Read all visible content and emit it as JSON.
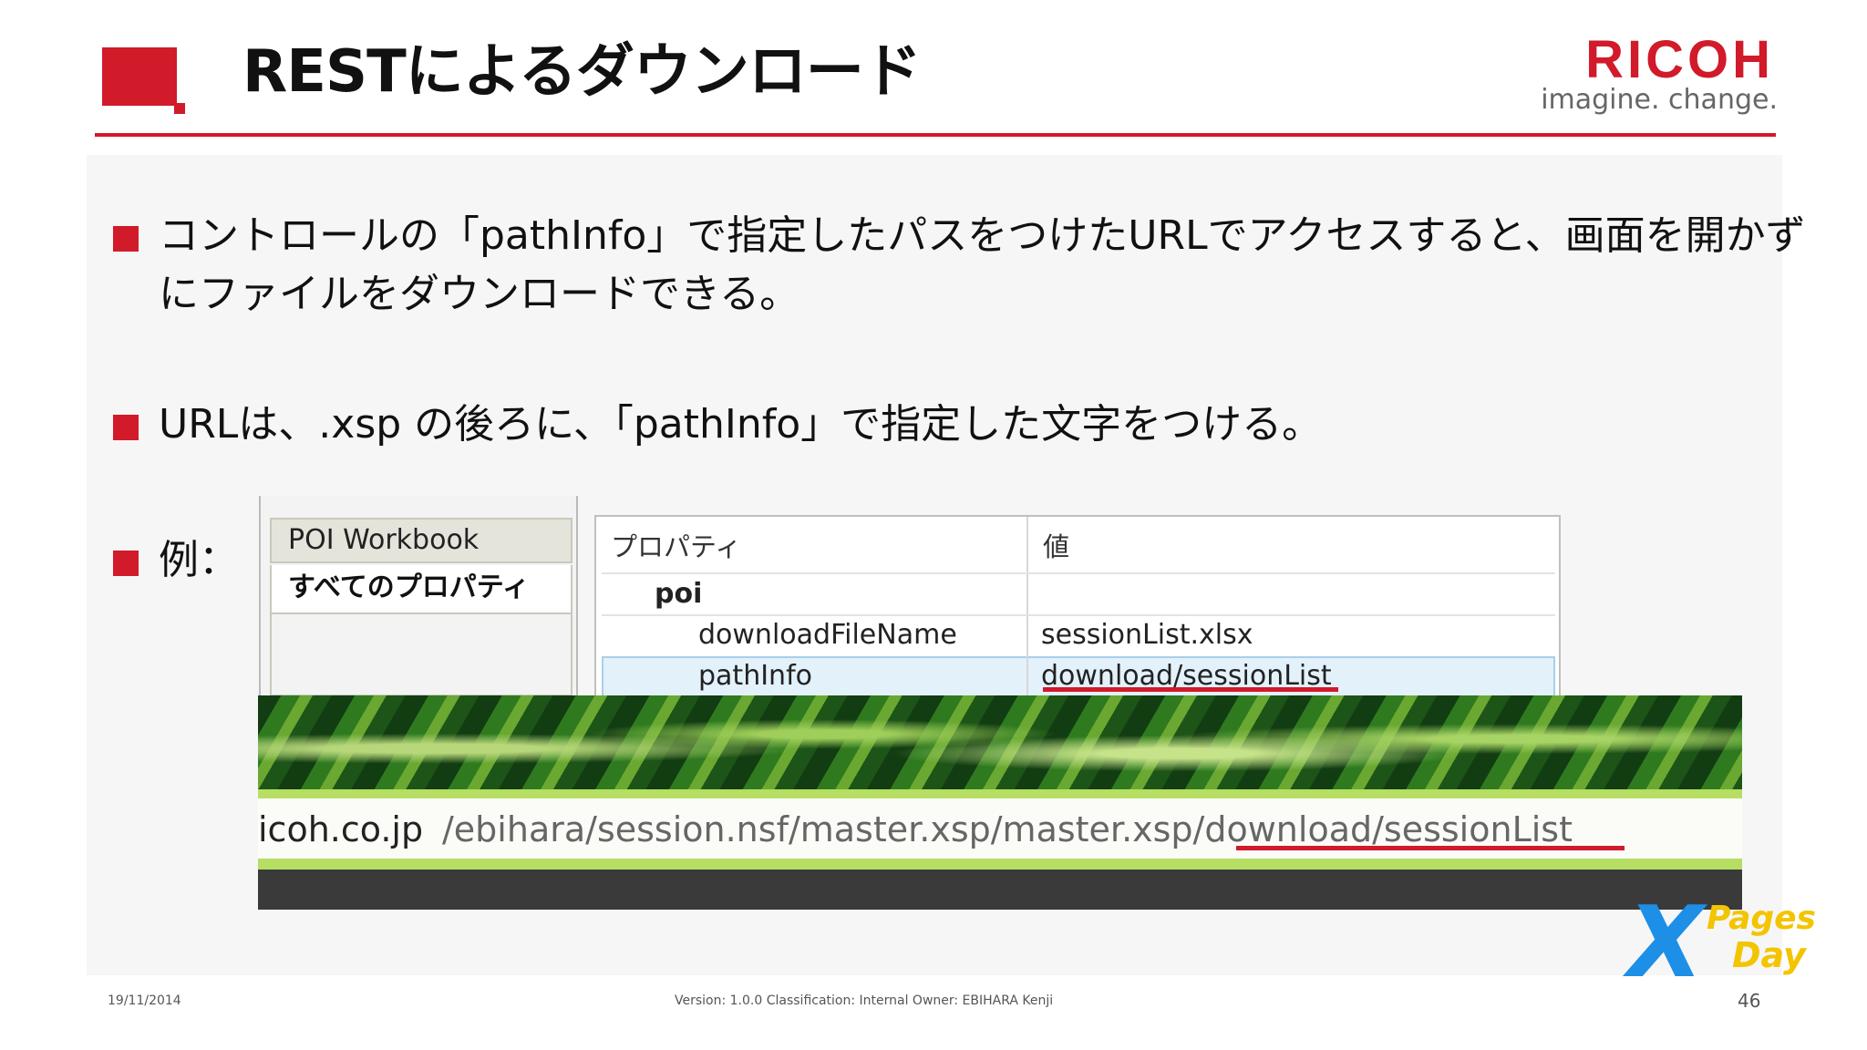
{
  "header": {
    "title": "RESTによるダウンロード",
    "logo_brand": "RICOH",
    "logo_tagline": "imagine. change."
  },
  "bullets": [
    {
      "line1": "コントロールの「pathInfo」で指定したパスをつけたURLでアクセスすると、画面を開かず",
      "line2": "にファイルをダウンロードできる。"
    },
    {
      "line1": "URLは、.xsp の後ろに、「pathInfo」で指定した文字をつける。"
    },
    {
      "line1": "例："
    }
  ],
  "properties_panel": {
    "tabs": [
      "POI Workbook",
      "すべてのプロパティ"
    ],
    "column_headers": [
      "プロパティ",
      "値"
    ],
    "rows": [
      {
        "name": "poi",
        "value": ""
      },
      {
        "name": "downloadFileName",
        "value": "sessionList.xlsx"
      },
      {
        "name": "pathInfo",
        "value": "download/sessionList"
      }
    ]
  },
  "url_example": {
    "host": "icoh.co.jp",
    "path": "/ebihara/session.nsf/master.xsp/master.xsp/download/sessionList"
  },
  "event_logo": {
    "x": "X",
    "pages": "Pages",
    "day": "Day"
  },
  "footer": {
    "date": "19/11/2014",
    "meta": "Version: 1.0.0 Classification: Internal  Owner: EBIHARA Kenji",
    "page_number": "46"
  },
  "colors": {
    "accent": "#d11a2a",
    "selection": "#e3f1fb",
    "banner_green": "#b6de63"
  }
}
